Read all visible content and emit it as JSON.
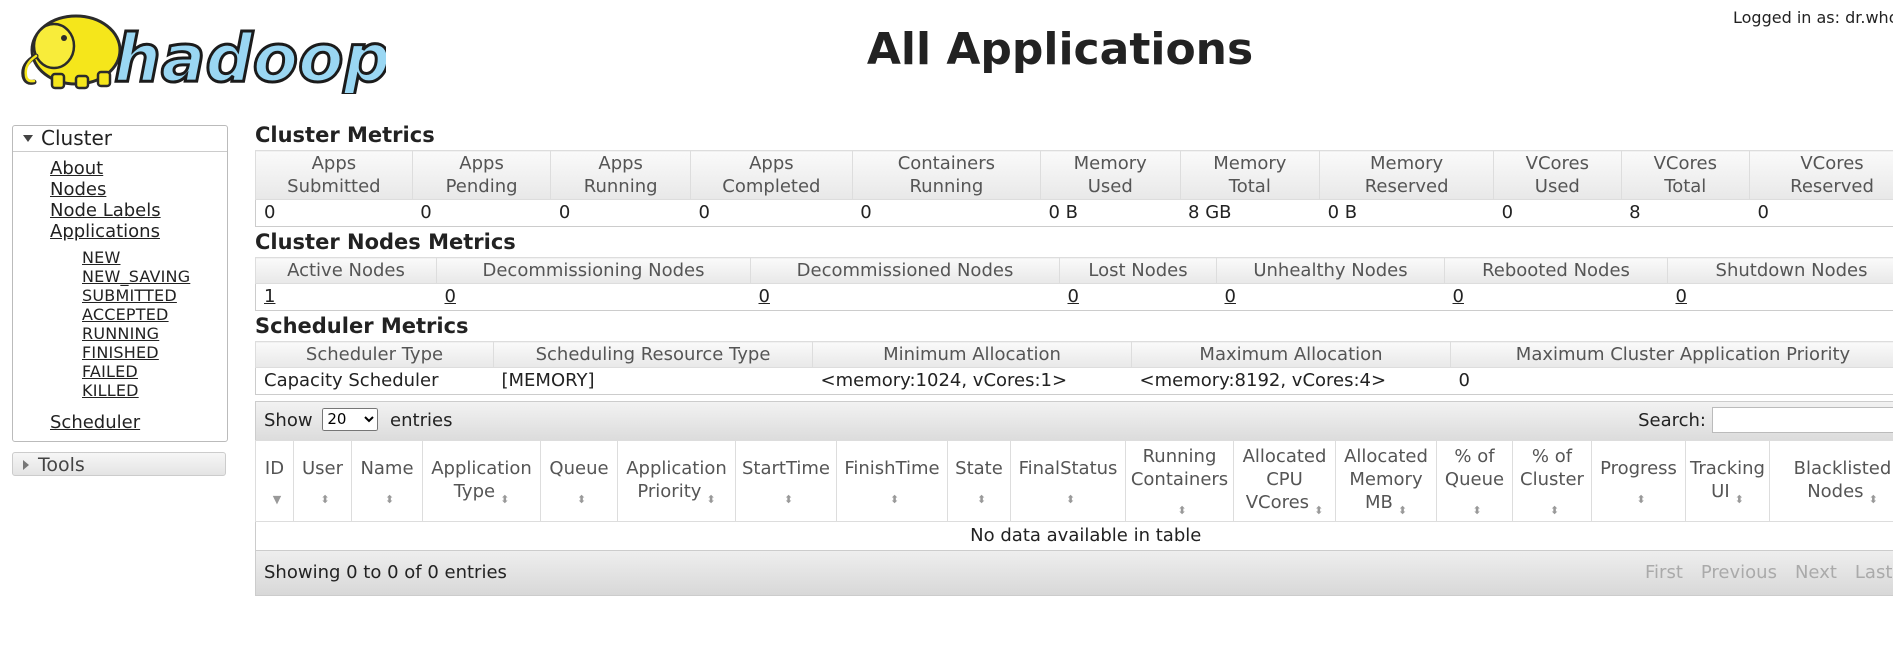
{
  "header": {
    "logo_text": "hadoop",
    "page_title": "All Applications",
    "login_text": "Logged in as: dr.who"
  },
  "sidebar": {
    "cluster_title": "Cluster",
    "items": [
      {
        "label": "About"
      },
      {
        "label": "Nodes"
      },
      {
        "label": "Node Labels"
      },
      {
        "label": "Applications"
      }
    ],
    "app_states": [
      "NEW",
      "NEW_SAVING",
      "SUBMITTED",
      "ACCEPTED",
      "RUNNING",
      "FINISHED",
      "FAILED",
      "KILLED"
    ],
    "scheduler_label": "Scheduler",
    "tools_title": "Tools"
  },
  "cluster_metrics": {
    "title": "Cluster Metrics",
    "headers": [
      [
        "Apps",
        "Submitted"
      ],
      [
        "Apps",
        "Pending"
      ],
      [
        "Apps",
        "Running"
      ],
      [
        "Apps",
        "Completed"
      ],
      [
        "Containers",
        "Running"
      ],
      [
        "Memory",
        "Used"
      ],
      [
        "Memory",
        "Total"
      ],
      [
        "Memory",
        "Reserved"
      ],
      [
        "VCores",
        "Used"
      ],
      [
        "VCores",
        "Total"
      ],
      [
        "VCores",
        "Reserved"
      ]
    ],
    "values": [
      "0",
      "0",
      "0",
      "0",
      "0",
      "0 B",
      "8 GB",
      "0 B",
      "0",
      "8",
      "0"
    ]
  },
  "node_metrics": {
    "title": "Cluster Nodes Metrics",
    "headers": [
      "Active Nodes",
      "Decommissioning Nodes",
      "Decommissioned Nodes",
      "Lost Nodes",
      "Unhealthy Nodes",
      "Rebooted Nodes",
      "Shutdown Nodes"
    ],
    "values": [
      "1",
      "0",
      "0",
      "0",
      "0",
      "0",
      "0"
    ]
  },
  "scheduler_metrics": {
    "title": "Scheduler Metrics",
    "headers": [
      "Scheduler Type",
      "Scheduling Resource Type",
      "Minimum Allocation",
      "Maximum Allocation",
      "Maximum Cluster Application Priority"
    ],
    "values": [
      "Capacity Scheduler",
      "[MEMORY]",
      "<memory:1024, vCores:1>",
      "<memory:8192, vCores:4>",
      "0"
    ]
  },
  "apps_table": {
    "show_label": "Show",
    "entries_label": "entries",
    "page_size": "20",
    "search_label": "Search:",
    "search_value": "",
    "columns": [
      [
        "ID"
      ],
      [
        "User"
      ],
      [
        "Name"
      ],
      [
        "Application",
        "Type"
      ],
      [
        "Queue"
      ],
      [
        "Application",
        "Priority"
      ],
      [
        "StartTime"
      ],
      [
        "FinishTime"
      ],
      [
        "State"
      ],
      [
        "FinalStatus"
      ],
      [
        "Running",
        "Containers"
      ],
      [
        "Allocated",
        "CPU",
        "VCores"
      ],
      [
        "Allocated",
        "Memory",
        "MB"
      ],
      [
        "% of",
        "Queue"
      ],
      [
        "% of",
        "Cluster"
      ],
      [
        "Progress"
      ],
      [
        "Tracking",
        "UI"
      ],
      [
        "Blacklisted",
        "Nodes"
      ]
    ],
    "empty_message": "No data available in table",
    "info_text": "Showing 0 to 0 of 0 entries",
    "pager": [
      "First",
      "Previous",
      "Next",
      "Last"
    ]
  }
}
